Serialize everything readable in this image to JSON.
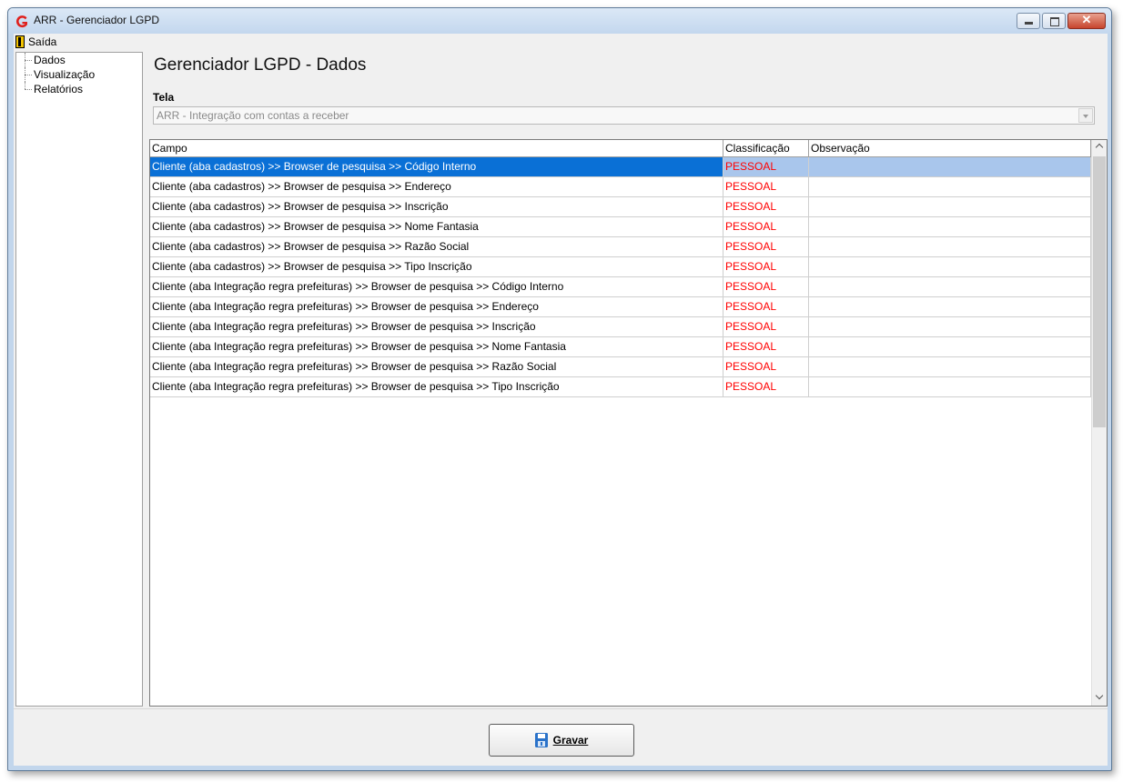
{
  "window": {
    "title": "ARR - Gerenciador LGPD"
  },
  "menu": {
    "exit_label": "Saída"
  },
  "tree": {
    "items": [
      "Dados",
      "Visualização",
      "Relatórios"
    ]
  },
  "main": {
    "page_title": "Gerenciador LGPD - Dados",
    "tela_label": "Tela",
    "tela_value": "ARR - Integração com contas a receber"
  },
  "grid": {
    "columns": [
      "Campo",
      "Classificação",
      "Observação"
    ],
    "selected_row": 0,
    "rows": [
      {
        "campo": "Cliente (aba cadastros) >> Browser de pesquisa >> Código Interno",
        "classificacao": "PESSOAL",
        "observacao": ""
      },
      {
        "campo": "Cliente (aba cadastros) >> Browser de pesquisa >> Endereço",
        "classificacao": "PESSOAL",
        "observacao": ""
      },
      {
        "campo": "Cliente (aba cadastros) >> Browser de pesquisa >> Inscrição",
        "classificacao": "PESSOAL",
        "observacao": ""
      },
      {
        "campo": "Cliente (aba cadastros) >> Browser de pesquisa >> Nome Fantasia",
        "classificacao": "PESSOAL",
        "observacao": ""
      },
      {
        "campo": "Cliente (aba cadastros) >> Browser de pesquisa >> Razão Social",
        "classificacao": "PESSOAL",
        "observacao": ""
      },
      {
        "campo": "Cliente (aba cadastros) >> Browser de pesquisa >> Tipo Inscrição",
        "classificacao": "PESSOAL",
        "observacao": ""
      },
      {
        "campo": "Cliente (aba Integração regra prefeituras) >> Browser de pesquisa >> Código Interno",
        "classificacao": "PESSOAL",
        "observacao": ""
      },
      {
        "campo": "Cliente (aba Integração regra prefeituras) >> Browser de pesquisa >> Endereço",
        "classificacao": "PESSOAL",
        "observacao": ""
      },
      {
        "campo": "Cliente (aba Integração regra prefeituras) >> Browser de pesquisa >> Inscrição",
        "classificacao": "PESSOAL",
        "observacao": ""
      },
      {
        "campo": "Cliente (aba Integração regra prefeituras) >> Browser de pesquisa >> Nome Fantasia",
        "classificacao": "PESSOAL",
        "observacao": ""
      },
      {
        "campo": "Cliente (aba Integração regra prefeituras) >> Browser de pesquisa >> Razão Social",
        "classificacao": "PESSOAL",
        "observacao": ""
      },
      {
        "campo": "Cliente (aba Integração regra prefeituras) >> Browser de pesquisa >> Tipo Inscrição",
        "classificacao": "PESSOAL",
        "observacao": ""
      }
    ]
  },
  "footer": {
    "save_label": "Gravar"
  },
  "colors": {
    "selection": "#0a70d6",
    "classification_text": "#ff0000",
    "window_frame": "#c2d6ec"
  },
  "icons": {
    "app": "app-logo-icon",
    "exit": "exit-door-icon",
    "save": "floppy-disk-icon"
  }
}
